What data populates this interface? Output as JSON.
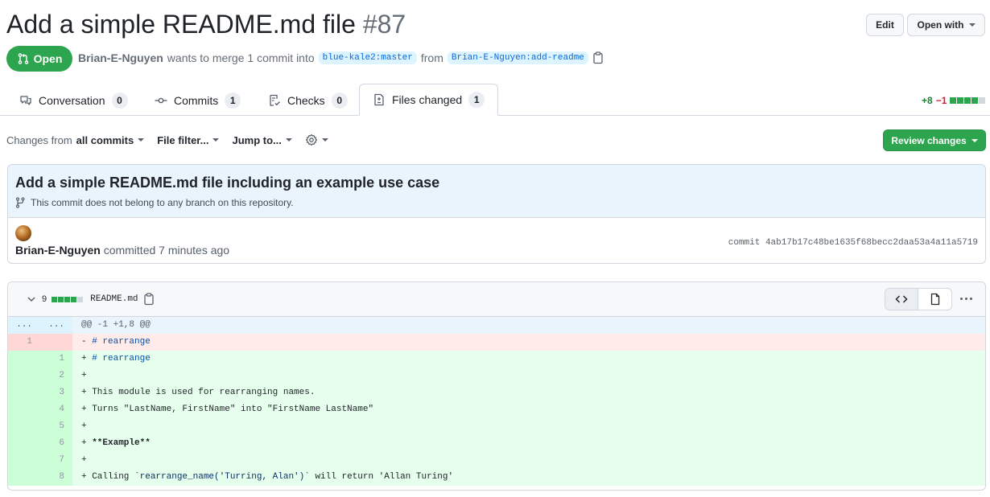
{
  "pr": {
    "title": "Add a simple README.md file",
    "number": "#87",
    "state": "Open",
    "author": "Brian-E-Nguyen",
    "merge_text": "wants to merge 1 commit into",
    "base_branch": "blue-kale2:master",
    "from_text": "from",
    "head_branch": "Brian-E-Nguyen:add-readme"
  },
  "header_actions": {
    "edit": "Edit",
    "open_with": "Open with"
  },
  "tabs": [
    {
      "label": "Conversation",
      "count": "0"
    },
    {
      "label": "Commits",
      "count": "1"
    },
    {
      "label": "Checks",
      "count": "0"
    },
    {
      "label": "Files changed",
      "count": "1",
      "selected": true
    }
  ],
  "diffstat": {
    "additions": "+8",
    "deletions": "−1"
  },
  "toolbar": {
    "changes_from": "Changes from",
    "all_commits": "all commits",
    "file_filter": "File filter...",
    "jump_to": "Jump to...",
    "review_changes": "Review changes"
  },
  "commit": {
    "title": "Add a simple README.md file including an example use case",
    "warning": "This commit does not belong to any branch on this repository.",
    "author": "Brian-E-Nguyen",
    "committed_text": "committed 7 minutes ago",
    "sha_label": "commit 4ab17b17c48be1635f68becc2daa53a4a11a5719"
  },
  "file": {
    "changes_count": "9",
    "name": "README.md",
    "hunk_old": "...",
    "hunk_new": "...",
    "hunk": "@@ -1 +1,8 @@",
    "lines": [
      {
        "type": "del",
        "old": "1",
        "new": "",
        "prefix": "- ",
        "text": "# rearrange",
        "style": "md-head"
      },
      {
        "type": "add",
        "old": "",
        "new": "1",
        "prefix": "+ ",
        "text": "# rearrange",
        "style": "md-head"
      },
      {
        "type": "add",
        "old": "",
        "new": "2",
        "prefix": "+",
        "text": "",
        "style": ""
      },
      {
        "type": "add",
        "old": "",
        "new": "3",
        "prefix": "+ ",
        "text": "This module is used for rearranging names.",
        "style": ""
      },
      {
        "type": "add",
        "old": "",
        "new": "4",
        "prefix": "+ ",
        "text": "Turns \"LastName, FirstName\" into \"FirstName LastName\"",
        "style": ""
      },
      {
        "type": "add",
        "old": "",
        "new": "5",
        "prefix": "+",
        "text": "",
        "style": ""
      },
      {
        "type": "add",
        "old": "",
        "new": "6",
        "prefix": "+ ",
        "text": "**Example**",
        "style": "md-bold"
      },
      {
        "type": "add",
        "old": "",
        "new": "7",
        "prefix": "+",
        "text": "",
        "style": ""
      },
      {
        "type": "add",
        "old": "",
        "new": "8",
        "prefix": "+ ",
        "text": "Calling ",
        "code": "`rearrange_name('Turring, Alan')`",
        "rest": " will return 'Allan Turing'",
        "style": ""
      }
    ]
  },
  "colors": {
    "open_green": "#2da44e",
    "addition_bg": "#e6ffec",
    "deletion_bg": "#ffebe9",
    "hunk_bg": "#ddf4ff"
  }
}
